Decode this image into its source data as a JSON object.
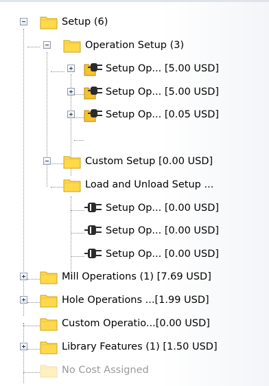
{
  "tree": {
    "items": [
      {
        "label": "Setup (6)",
        "icon": "folder-icon",
        "expander": "minus"
      },
      {
        "label": "Operation Setup (3)",
        "icon": "folder-icon",
        "expander": "minus"
      },
      {
        "label": "Setup Op... [5.00 USD]",
        "icon": "operation-plug-icon",
        "expander": "plus"
      },
      {
        "label": "Setup Op... [5.00 USD]",
        "icon": "operation-plug-icon",
        "expander": "plus"
      },
      {
        "label": "Setup Op... [0.05 USD]",
        "icon": "operation-plug-icon",
        "expander": "plus"
      },
      {
        "label": "Custom Setup  [0.00 USD]",
        "icon": "folder-icon",
        "expander": "none"
      },
      {
        "label": "Load and Unload Setup ...",
        "icon": "folder-icon",
        "expander": "minus"
      },
      {
        "label": "Setup Op... [0.00 USD]",
        "icon": "operation-plug-icon",
        "expander": "none"
      },
      {
        "label": "Setup Op... [0.00 USD]",
        "icon": "operation-plug-icon",
        "expander": "none"
      },
      {
        "label": "Setup Op... [0.00 USD]",
        "icon": "operation-plug-icon",
        "expander": "none"
      },
      {
        "label": "Mill Operations (1) [7.69 USD]",
        "icon": "folder-icon",
        "expander": "plus"
      },
      {
        "label": "Hole Operations ...[1.99 USD]",
        "icon": "folder-icon",
        "expander": "plus"
      },
      {
        "label": "Custom Operatio...[0.00 USD]",
        "icon": "folder-icon",
        "expander": "none"
      },
      {
        "label": "Library Features (1) [1.50 USD]",
        "icon": "folder-icon",
        "expander": "plus"
      },
      {
        "label": "No Cost Assigned",
        "icon": "folder-icon",
        "expander": "none",
        "disabled": true
      }
    ]
  },
  "colors": {
    "folder_fill": "#ffd94a",
    "folder_edge": "#c9a21a",
    "operation_fill": "#f5c231",
    "disabled_text": "#9a9a9a"
  }
}
